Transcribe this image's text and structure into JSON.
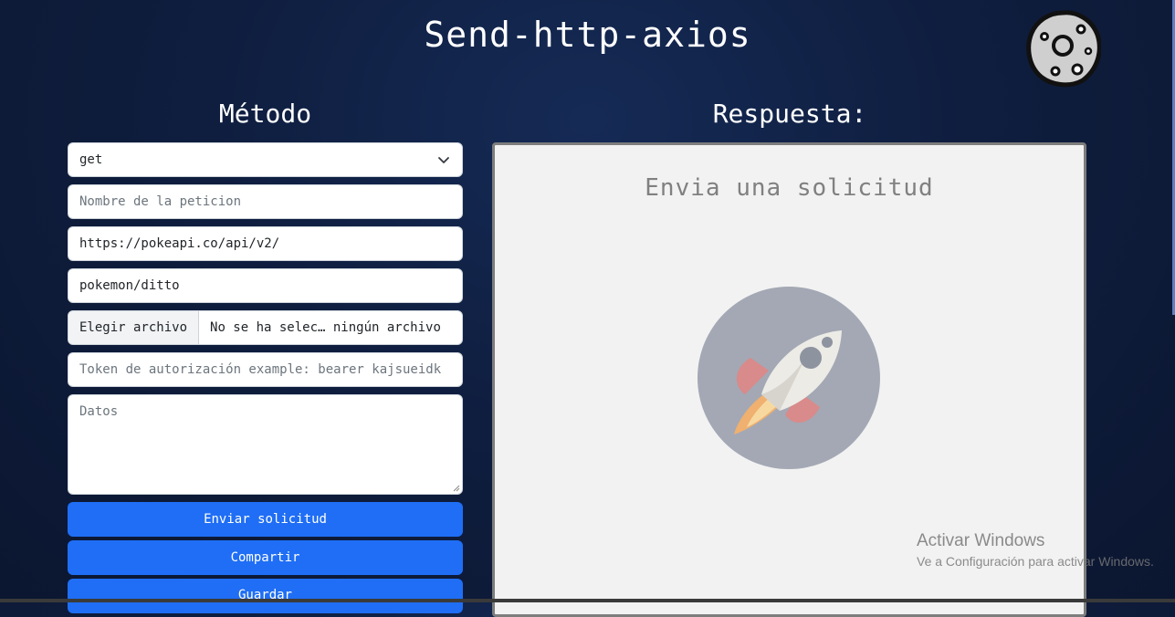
{
  "header": {
    "title": "Send-http-axios",
    "logo_icon": "moon-icon"
  },
  "left": {
    "title": "Método",
    "method_select": {
      "value": "get"
    },
    "name_input": {
      "placeholder": "Nombre de la peticion"
    },
    "url_input": {
      "value": "https://pokeapi.co/api/v2/"
    },
    "path_input": {
      "value": "pokemon/ditto"
    },
    "file_input": {
      "button_label": "Elegir archivo",
      "status": "No se ha selec… ningún archivo"
    },
    "token_input": {
      "placeholder": "Token de autorización example: bearer kajsueidk"
    },
    "data_textarea": {
      "placeholder": "Datos"
    },
    "buttons": {
      "send": "Enviar solicitud",
      "share": "Compartir",
      "save": "Guardar"
    }
  },
  "right": {
    "title": "Respuesta:",
    "empty_message": "Envia una solicitud",
    "illustration_icon": "rocket-icon"
  },
  "watermark": {
    "title": "Activar Windows",
    "subtitle": "Ve a Configuración para activar Windows."
  },
  "colors": {
    "background": "#0f1e3f",
    "primary_button": "#1f6ef5",
    "panel": "#f2f2f2"
  }
}
